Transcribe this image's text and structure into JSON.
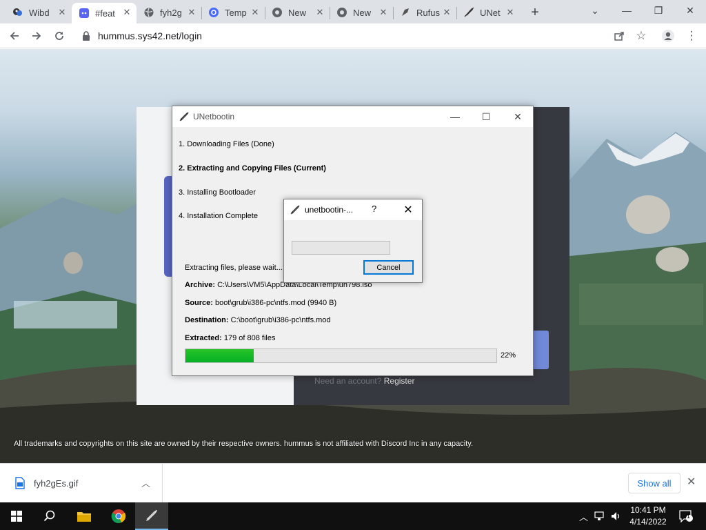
{
  "browser": {
    "tabs": [
      {
        "label": "Wibd",
        "icon": "wibd-favicon"
      },
      {
        "label": "#feat",
        "icon": "discord-favicon"
      },
      {
        "label": "fyh2g",
        "icon": "globe-favicon"
      },
      {
        "label": "Temp",
        "icon": "at-sign-favicon"
      },
      {
        "label": "New",
        "icon": "chrome-favicon"
      },
      {
        "label": "New",
        "icon": "chrome-favicon"
      },
      {
        "label": "Rufus",
        "icon": "rufus-favicon"
      },
      {
        "label": "UNet",
        "icon": "unetbootin-favicon"
      }
    ],
    "new_tab": "+",
    "url": "hummus.sys42.net/login"
  },
  "page": {
    "need_account": "Need an account?",
    "register": "Register",
    "footer": "All trademarks and copyrights on this site are owned by their respective owners. hummus is not affiliated with Discord Inc in any capacity."
  },
  "unetbootin": {
    "title": "UNetbootin",
    "steps": [
      "1. Downloading Files (Done)",
      "2. Extracting and Copying Files (Current)",
      "3. Installing Bootloader",
      "4. Installation Complete"
    ],
    "status": "Extracting files, please wait...",
    "archive_label": "Archive:",
    "archive_value": "C:\\Users\\VM5\\AppData\\Local\\Temp\\un798.iso",
    "source_label": "Source:",
    "source_value": "boot\\grub\\i386-pc\\ntfs.mod (9940 B)",
    "destination_label": "Destination:",
    "destination_value": "C:\\boot\\grub\\i386-pc\\ntfs.mod",
    "extracted_label": "Extracted:",
    "extracted_value": "179 of 808 files",
    "progress_percent": 22,
    "progress_text": "22%"
  },
  "subdialog": {
    "title": "unetbootin-...",
    "help": "?",
    "cancel": "Cancel"
  },
  "downloads": {
    "file_name": "fyh2gEs.gif",
    "show_all": "Show all"
  },
  "taskbar": {
    "time": "10:41 PM",
    "date": "4/14/2022",
    "notification_count": "1"
  },
  "colors": {
    "progress_green": "#06b025",
    "accent_blue": "#0078d7",
    "chrome_link": "#1a73e8"
  }
}
